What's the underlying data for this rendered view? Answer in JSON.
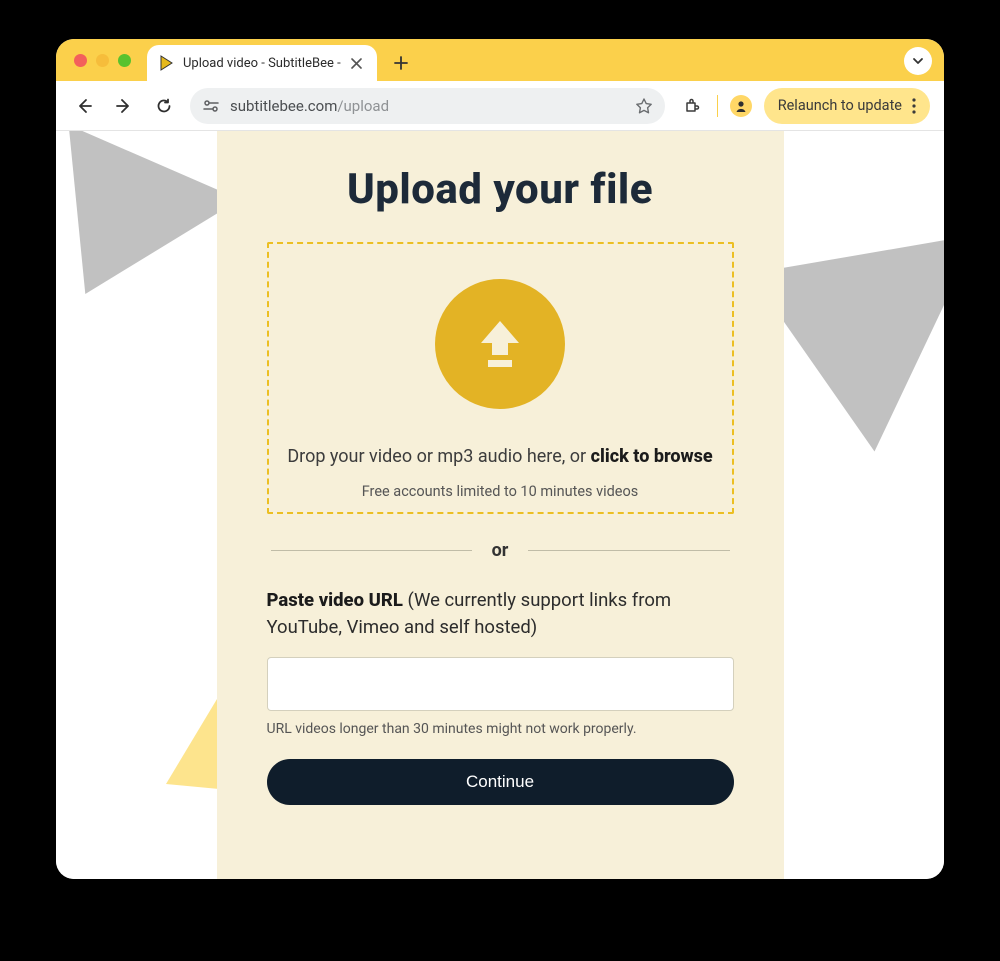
{
  "browser": {
    "tab_title": "Upload video - SubtitleBee - ",
    "new_tab_tooltip": "New tab",
    "url_domain": "subtitlebee.com",
    "url_path": "/upload",
    "relaunch_label": "Relaunch to update"
  },
  "page": {
    "heading": "Upload your file",
    "drop_text_prefix": "Drop your video or mp3 audio here, or ",
    "drop_text_action": "click to browse",
    "drop_limit": "Free accounts limited to 10 minutes videos",
    "divider_label": "or",
    "paste_label_bold": "Paste video URL",
    "paste_label_rest": " (We currently support links from YouTube, Vimeo and self hosted)",
    "url_value": "",
    "url_hint": "URL videos longer than 30 minutes might not work properly.",
    "continue_label": "Continue"
  }
}
